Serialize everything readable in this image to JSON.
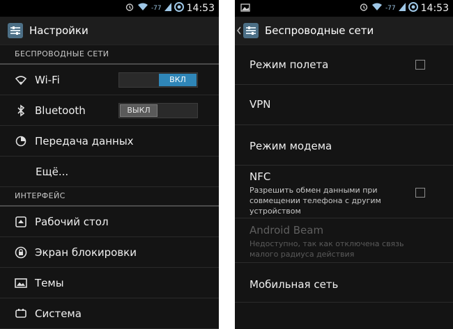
{
  "status": {
    "signal_label": "-77",
    "time": "14:53"
  },
  "left": {
    "title": "Настройки",
    "sections": [
      {
        "label": "БЕСПРОВОДНЫЕ СЕТИ"
      },
      {
        "label": "ИНТЕРФЕЙС"
      }
    ],
    "wireless": [
      {
        "label": "Wi-Fi",
        "icon": "wifi-icon",
        "toggle": "ВКЛ",
        "state": "on"
      },
      {
        "label": "Bluetooth",
        "icon": "bluetooth-icon",
        "toggle": "ВЫКЛ",
        "state": "off"
      },
      {
        "label": "Передача данных",
        "icon": "data-usage-icon"
      },
      {
        "label": "Ещё..."
      }
    ],
    "interface": [
      {
        "label": "Рабочий стол",
        "icon": "home-icon"
      },
      {
        "label": "Экран блокировки",
        "icon": "lock-icon"
      },
      {
        "label": "Темы",
        "icon": "themes-icon"
      },
      {
        "label": "Система",
        "icon": "system-icon"
      }
    ]
  },
  "right": {
    "title": "Беспроводные сети",
    "items": [
      {
        "title": "Режим полета",
        "checkbox": true,
        "checked": false
      },
      {
        "title": "VPN"
      },
      {
        "title": "Режим модема"
      },
      {
        "title": "NFC",
        "summary": "Разрешить обмен данными при совмещении телефона с другим устройством",
        "checkbox": true,
        "checked": false
      },
      {
        "title": "Android Beam",
        "summary": "Недоступно, так как отключена связь малого радиуса действия",
        "disabled": true
      },
      {
        "title": "Мобильная сеть"
      }
    ]
  },
  "colors": {
    "accent": "#2f86b8",
    "background": "#141414"
  }
}
